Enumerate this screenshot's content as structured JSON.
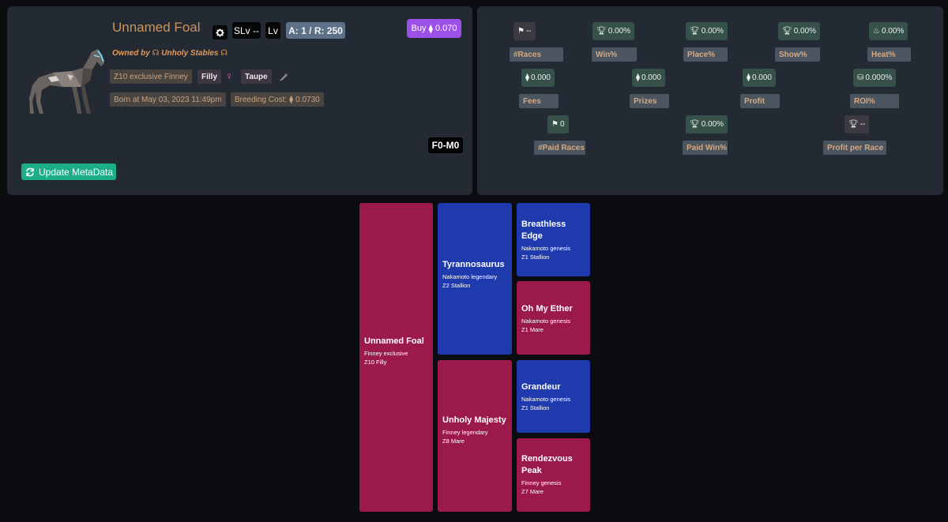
{
  "horse": {
    "name": "Unnamed Foal",
    "slv": "SLv --",
    "lv": "Lv",
    "ar": "A: 1 / R: 250",
    "owned_prefix": "Owned by",
    "owner": "Unholy Stables",
    "zone_tag": "Z10 exclusive Finney",
    "gender": "Filly",
    "color": "Taupe",
    "born": "Born at May 03, 2023 11:49pm",
    "breeding_cost": "Breeding Cost:",
    "breeding_value": "0.0730",
    "buy_label": "Buy",
    "buy_value": "0.070",
    "family": "F0-M0",
    "update_label": "Update MetaData"
  },
  "stats": {
    "races": {
      "value": "--",
      "label": "#Races"
    },
    "win": {
      "value": "0.00%",
      "label": "Win%"
    },
    "place": {
      "value": "0.00%",
      "label": "Place%"
    },
    "show": {
      "value": "0.00%",
      "label": "Show%"
    },
    "heat": {
      "value": "0.00%",
      "label": "Heat%"
    },
    "fees": {
      "value": "0.000",
      "label": "Fees"
    },
    "prizes": {
      "value": "0.000",
      "label": "Prizes"
    },
    "profit": {
      "value": "0.000",
      "label": "Profit"
    },
    "roi": {
      "value": "0.000%",
      "label": "ROI%"
    },
    "paid_races": {
      "value": "0",
      "label": "#Paid Races"
    },
    "paid_win": {
      "value": "0.00%",
      "label": "Paid Win%"
    },
    "profit_per_race": {
      "value": "--",
      "label": "Profit per Race"
    }
  },
  "tree": {
    "self": {
      "name": "Unnamed Foal",
      "bloodline": "Finney exclusive",
      "desc": "Z10 Filly"
    },
    "sire": {
      "name": "Tyrannosaurus",
      "bloodline": "Nakamoto legendary",
      "desc": "Z2 Stallion"
    },
    "dam": {
      "name": "Unholy Majesty",
      "bloodline": "Finney legendary",
      "desc": "Z8 Mare"
    },
    "sire_sire": {
      "name": "Breathless Edge",
      "bloodline": "Nakamoto genesis",
      "desc": "Z1 Stallion"
    },
    "sire_dam": {
      "name": "Oh My Ether",
      "bloodline": "Nakamoto genesis",
      "desc": "Z1 Mare"
    },
    "dam_sire": {
      "name": "Grandeur",
      "bloodline": "Nakamoto genesis",
      "desc": "Z1 Stallion"
    },
    "dam_dam": {
      "name": "Rendezvous Peak",
      "bloodline": "Finney genesis",
      "desc": "Z7 Mare"
    }
  },
  "colors": {
    "accent_purple": "#9b50e8",
    "accent_green": "#1cae88",
    "mare_pink": "#9b1a4a",
    "stallion_blue": "#1e3aad"
  },
  "icons": [
    "gear-icon",
    "pen-icon",
    "female-icon",
    "ethereum-icon",
    "flag-icon",
    "trophy-icon",
    "fire-icon",
    "coins-icon",
    "refresh-icon",
    "horseshoe-icon"
  ]
}
